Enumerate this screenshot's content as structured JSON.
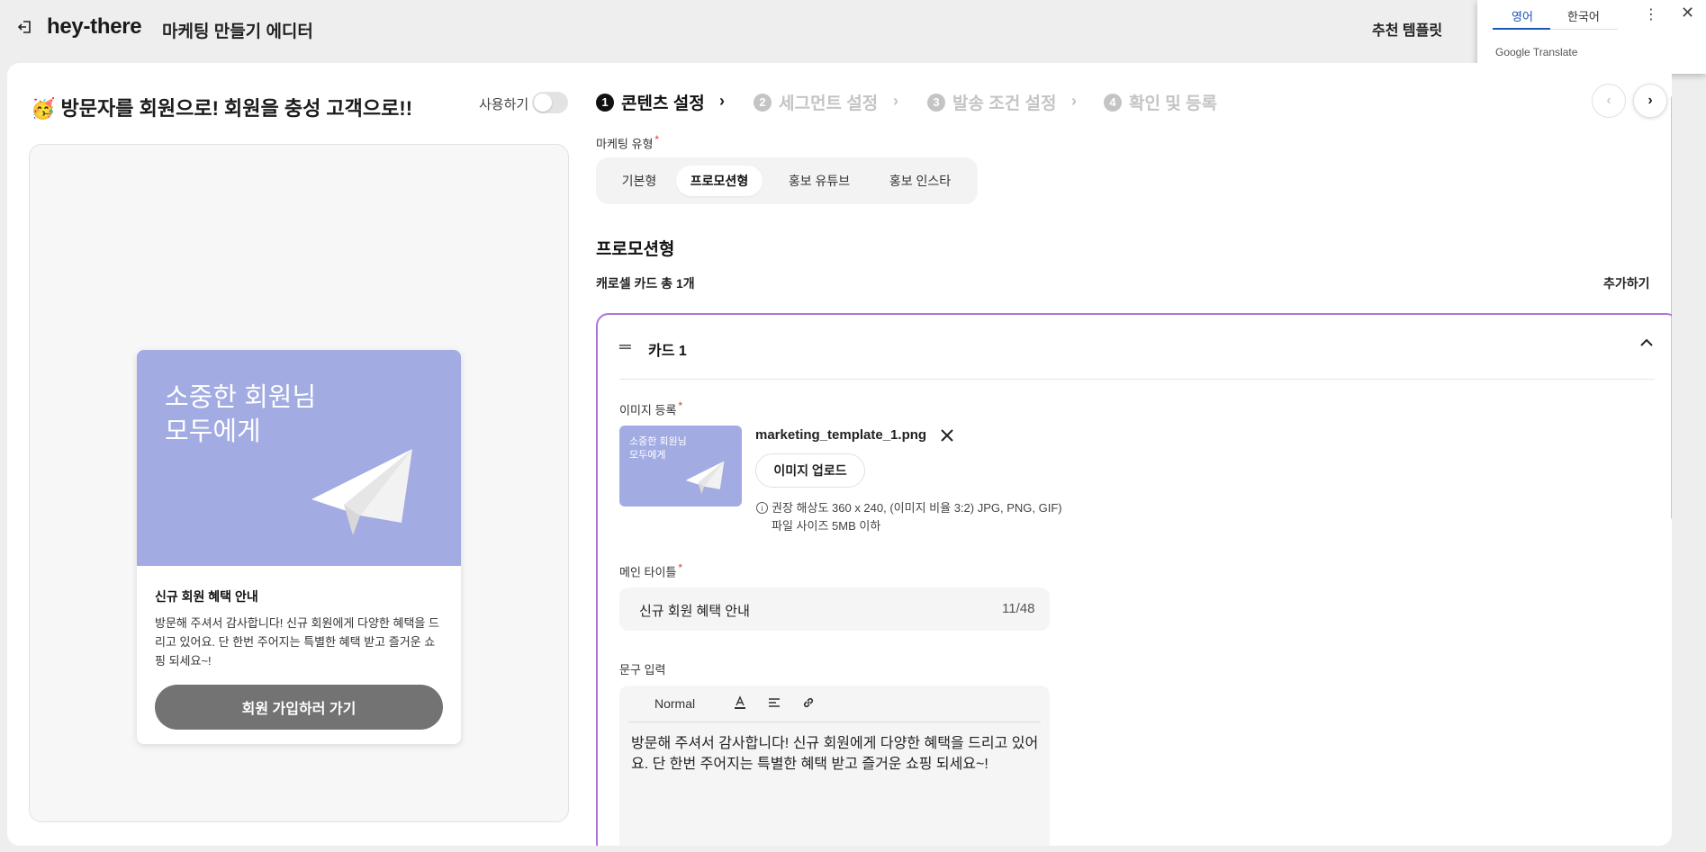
{
  "topbar": {
    "brand": "hey-there",
    "editor_title": "마케팅 만들기 에디터",
    "recommend_templates": "추천 템플릿"
  },
  "translate": {
    "tab_en": "영어",
    "tab_ko": "한국어",
    "brand_google": "Google",
    "brand_translate": "Translate"
  },
  "campaign": {
    "title": "방문자를 회원으로! 회원을 충성 고객으로!!",
    "use_label": "사용하기"
  },
  "preview": {
    "image_text": "소중한 회원님\n모두에게",
    "card_title": "신규 회원 혜택 안내",
    "card_body": "방문해 주셔서 감사합니다! 신규 회원에게 다양한 혜택을 드리고 있어요. 단 한번 주어지는 특별한 혜택 받고 즐거운 쇼핑 되세요~!",
    "cta": "회원 가입하러 가기"
  },
  "steps": [
    {
      "num": "1",
      "label": "콘텐츠 설정"
    },
    {
      "num": "2",
      "label": "세그먼트 설정"
    },
    {
      "num": "3",
      "label": "발송 조건 설정"
    },
    {
      "num": "4",
      "label": "확인 및 등록"
    }
  ],
  "form": {
    "marketing_type_label": "마케팅 유형",
    "types": [
      "기본형",
      "프로모션형",
      "홍보 유튜브",
      "홍보 인스타"
    ],
    "selected_type": "프로모션형",
    "section_title": "프로모션형",
    "carousel_count": "캐로셀 카드 총 1개",
    "add_label": "추가하기",
    "card": {
      "name": "카드 1",
      "image_label": "이미지 등록",
      "thumb_text": "소중한 회원님\n모두에게",
      "filename": "marketing_template_1.png",
      "upload_label": "이미지 업로드",
      "hint_resolution": "권장 해상도 360 x 240, (이미지 비율 3:2) JPG, PNG, GIF)",
      "hint_size": "파일 사이즈 5MB 이하",
      "main_title_label": "메인 타이틀",
      "main_title_value": "신규 회원 혜택 안내",
      "main_title_count": "11/48",
      "text_label": "문구 입력",
      "toolbar_normal": "Normal",
      "text_value": "방문해 주셔서 감사합니다! 신규 회원에게 다양한 혜택을 드리고 있어요. 단 한번 주어지는 특별한 혜택 받고 즐거운 쇼핑 되세요~!"
    }
  },
  "colors": {
    "accent_border": "#b075d6",
    "preview_image_bg": "#a2abe2",
    "cta_bg": "#737373",
    "translate_blue": "#1a56b8"
  }
}
